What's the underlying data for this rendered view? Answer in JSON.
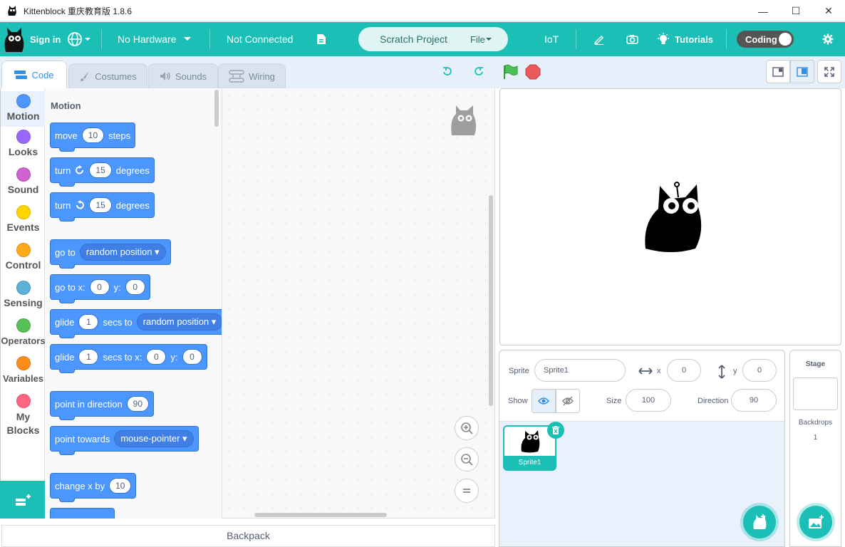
{
  "app": {
    "title": "Kittenblock 重庆教育版 1.8.6"
  },
  "menubar": {
    "sign_in": "Sign in",
    "hardware": "No Hardware",
    "connection": "Not Connected",
    "project_name": "Scratch Project",
    "file": "File",
    "iot": "IoT",
    "tutorials": "Tutorials",
    "coding": "Coding"
  },
  "tabs": {
    "code": "Code",
    "costumes": "Costumes",
    "sounds": "Sounds",
    "wiring": "Wiring"
  },
  "categories": [
    {
      "label": "Motion",
      "color": "#4c97ff"
    },
    {
      "label": "Looks",
      "color": "#9966ff"
    },
    {
      "label": "Sound",
      "color": "#cf63cf"
    },
    {
      "label": "Events",
      "color": "#ffd500"
    },
    {
      "label": "Control",
      "color": "#ffab19"
    },
    {
      "label": "Sensing",
      "color": "#5cb1d6"
    },
    {
      "label": "Operators",
      "color": "#59c059"
    },
    {
      "label": "Variables",
      "color": "#ff8c1a"
    },
    {
      "label": "My",
      "label2": "Blocks",
      "color": "#ff6680"
    }
  ],
  "palette": {
    "heading": "Motion",
    "move": {
      "a": "move",
      "n": "10",
      "b": "steps"
    },
    "turn_cw": {
      "a": "turn",
      "n": "15",
      "b": "degrees"
    },
    "turn_ccw": {
      "a": "turn",
      "n": "15",
      "b": "degrees"
    },
    "goto": {
      "a": "go to",
      "d": "random position"
    },
    "goto_xy": {
      "a": "go to x:",
      "x": "0",
      "b": "y:",
      "y": "0"
    },
    "glide": {
      "a": "glide",
      "n": "1",
      "b": "secs to",
      "d": "random position"
    },
    "glide_xy": {
      "a": "glide",
      "n": "1",
      "b": "secs to x:",
      "x": "0",
      "c": "y:",
      "y": "0"
    },
    "point_dir": {
      "a": "point in direction",
      "n": "90"
    },
    "point_towards": {
      "a": "point towards",
      "d": "mouse-pointer"
    },
    "change_x": {
      "a": "change x by",
      "n": "10"
    }
  },
  "backpack": "Backpack",
  "sprite_info": {
    "sprite_label": "Sprite",
    "sprite_name": "Sprite1",
    "x_label": "x",
    "x": "0",
    "y_label": "y",
    "y": "0",
    "show_label": "Show",
    "size_label": "Size",
    "size": "100",
    "direction_label": "Direction",
    "direction": "90"
  },
  "sprites": [
    {
      "name": "Sprite1"
    }
  ],
  "stage_panel": {
    "title": "Stage",
    "backdrops_label": "Backdrops",
    "backdrops_count": "1"
  }
}
